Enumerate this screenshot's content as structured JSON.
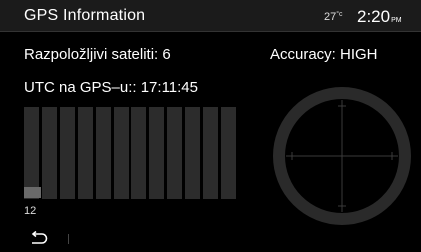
{
  "header": {
    "title": "GPS Information",
    "temperature": "27",
    "temp_unit": "°c",
    "time": "2:20",
    "ampm": "PM"
  },
  "gps": {
    "satellites_label": "Razpoložljivi sateliti: 6",
    "accuracy_label": "Accuracy: HIGH",
    "utc_label": "UTC na GPS–u:: 17:11:45"
  },
  "signal": {
    "bar_count": 12,
    "active_bar_index": 0,
    "active_bar_level": 0.12,
    "satellite_id": "12"
  },
  "icons": {
    "back": "back-arrow-icon",
    "compass": "sky-plot-compass-icon"
  },
  "colors": {
    "background": "#000000",
    "header": "#1b1b1b",
    "bar_empty": "#2c2c2c",
    "bar_signal": "#6a6a6a",
    "compass": "#2a2a2a"
  }
}
